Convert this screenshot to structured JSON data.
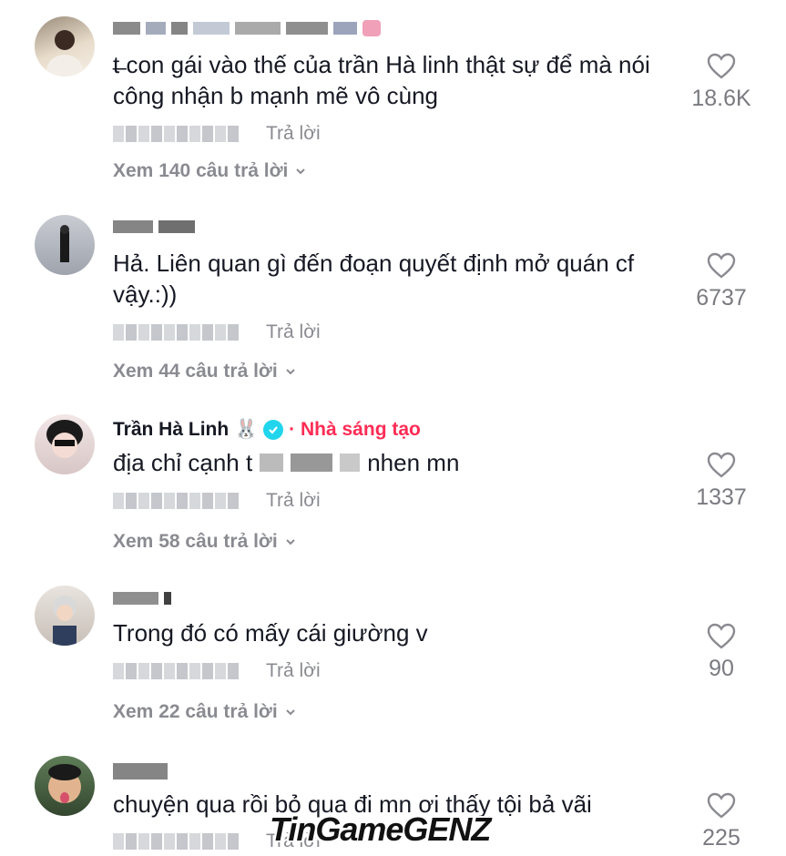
{
  "comments": [
    {
      "username_visible": "",
      "text": "t̶ con gái vào thế của trần Hà linh thật sự để mà nói công nhận b mạnh mẽ vô cùng",
      "reply_label": "Trả lời",
      "view_replies": "Xem 140 câu trả lời",
      "likes": "18.6K"
    },
    {
      "username_visible": "",
      "text": "Hả. Liên quan gì đến đoạn quyết định mở quán cf vậy.:))",
      "reply_label": "Trả lời",
      "view_replies": "Xem 44 câu trả lời",
      "likes": "6737"
    },
    {
      "username_visible": "Trần Hà Linh 🐰",
      "creator_badge": "· Nhà sáng tạo",
      "text_prefix": "địa chỉ cạnh t",
      "text_suffix": "nhen mn",
      "reply_label": "Trả lời",
      "view_replies": "Xem 58 câu trả lời",
      "likes": "1337"
    },
    {
      "username_visible": "",
      "text": "Trong đó có mấy cái giường v",
      "reply_label": "Trả lời",
      "view_replies": "Xem 22 câu trả lời",
      "likes": "90"
    },
    {
      "username_visible": "",
      "text": "chuyện qua rồi bỏ qua đi mn ơi thấy tội bả vãi",
      "reply_label": "Trả lời",
      "likes": "225"
    }
  ],
  "watermark": "TinGameGENZ",
  "colors": {
    "text": "#161823",
    "muted": "#8a8b91",
    "creator": "#fe2c55",
    "verified": "#20d5ec"
  },
  "icons": [
    "heart-outline-icon",
    "chevron-down-icon",
    "verified-check-icon"
  ]
}
